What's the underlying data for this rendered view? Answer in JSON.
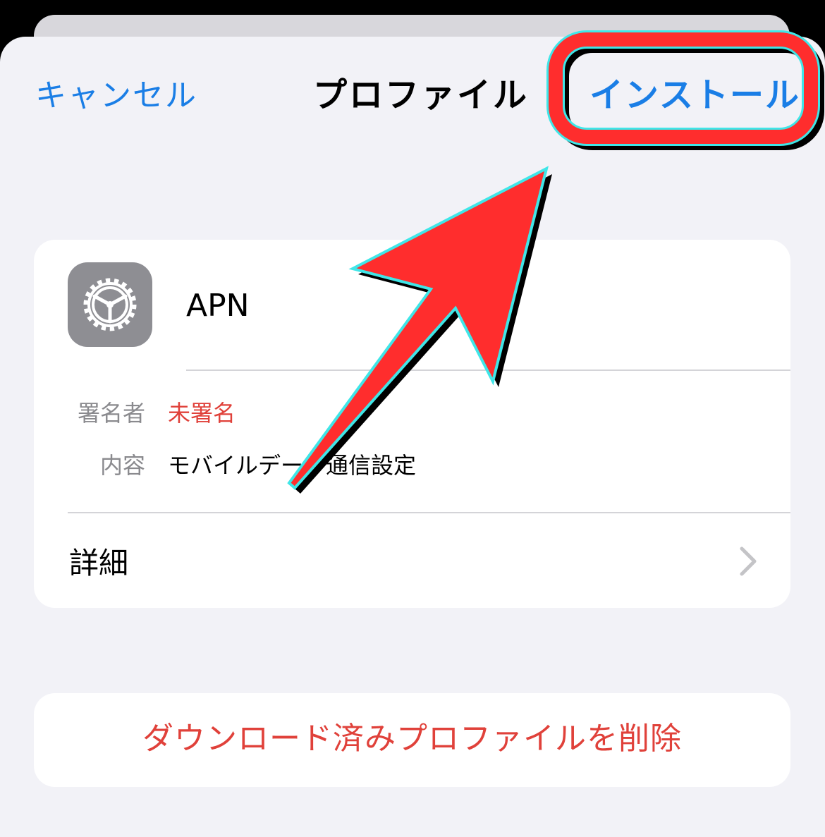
{
  "nav": {
    "cancel_label": "キャンセル",
    "title": "プロファイル",
    "install_label": "インストール"
  },
  "profile": {
    "icon": "gear-icon",
    "name": "APN",
    "signer_label": "署名者",
    "signer_value": "未署名",
    "contents_label": "内容",
    "contents_value": "モバイルデータ通信設定",
    "details_label": "詳細"
  },
  "actions": {
    "delete_label": "ダウンロード済みプロファイルを削除"
  },
  "colors": {
    "link_blue": "#1a7ee6",
    "destructive_red": "#e0413a",
    "highlight_red": "#ff2d2d",
    "highlight_outline": "#3fe6e8",
    "sheet_background": "#f2f2f7",
    "icon_gray": "#8e8e93"
  }
}
